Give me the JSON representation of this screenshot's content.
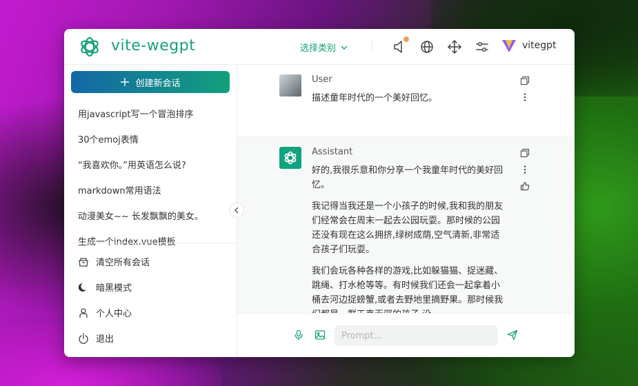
{
  "header": {
    "app_title": "vite-wegpt",
    "category_label": "选择类别",
    "user_name": "vitegpt"
  },
  "sidebar": {
    "new_chat_label": "创建新会话",
    "history": [
      "用javascript写一个冒泡排序",
      "30个emoj表情",
      "“我喜欢你。”用英语怎么说?",
      "markdown常用语法",
      "动漫美女~~ 长发飘飘的美女。",
      "生成一个index.vue模板"
    ],
    "actions": [
      {
        "label": "清空所有会话",
        "icon": "trash-icon"
      },
      {
        "label": "暗黑模式",
        "icon": "moon-icon"
      },
      {
        "label": "个人中心",
        "icon": "person-icon"
      },
      {
        "label": "退出",
        "icon": "power-icon"
      }
    ]
  },
  "chat": {
    "user": {
      "name": "User",
      "text": "描述童年时代的一个美好回忆。"
    },
    "assistant": {
      "name": "Assistant",
      "paragraphs": [
        "好的,我很乐意和你分享一个我童年时代的美好回忆。",
        "我记得当我还是一个小孩子的时候,我和我的朋友们经常会在周末一起去公园玩耍。那时候的公园还没有现在这么拥挤,绿树成荫,空气清新,非常适合孩子们玩耍。",
        "我们会玩各种各样的游戏,比如躲猫猫、捉迷藏、跳绳、打水枪等等。有时候我们还会一起拿着小桶去河边捉螃蟹,或者去野地里摘野果。那时候我们都是一群天真无邪的孩子,没"
      ]
    }
  },
  "input": {
    "placeholder": "Prompt..."
  },
  "colors": {
    "accent": "#17a07a",
    "gradient_start": "#1467a6",
    "gradient_end": "#12a07c",
    "notification": "#e6a15a"
  }
}
